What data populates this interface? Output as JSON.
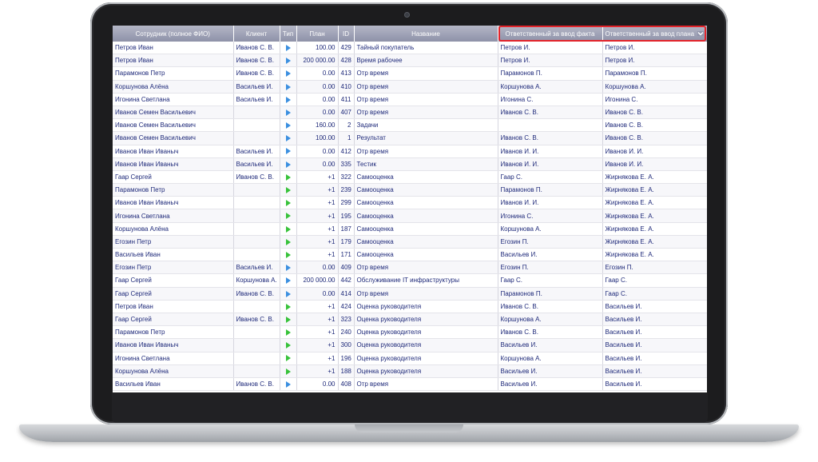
{
  "columns": {
    "employee": "Сотрудник (полное ФИО)",
    "client": "Клиент",
    "type": "Тип",
    "plan": "План",
    "id": "ID",
    "name": "Название",
    "resp_fact": "Ответственный за ввод факта",
    "resp_plan": "Ответственный за ввод плана",
    "sort_icon": "chevron-down-icon"
  },
  "rows": [
    {
      "employee": "Петров Иван",
      "client": "Иванов С. В.",
      "type": "blue",
      "plan": "100.00",
      "id": "429",
      "name": "Тайный покупатель",
      "resp_fact": "Петров И.",
      "resp_plan": "Петров И."
    },
    {
      "employee": "Петров Иван",
      "client": "Иванов С. В.",
      "type": "blue",
      "plan": "200 000.00",
      "id": "428",
      "name": "Время рабочее",
      "resp_fact": "Петров И.",
      "resp_plan": "Петров И."
    },
    {
      "employee": "Парамонов Петр",
      "client": "Иванов С. В.",
      "type": "blue",
      "plan": "0.00",
      "id": "413",
      "name": "Отр время",
      "resp_fact": "Парамонов П.",
      "resp_plan": "Парамонов П."
    },
    {
      "employee": "Коршунова Алёна",
      "client": "Васильев И.",
      "type": "blue",
      "plan": "0.00",
      "id": "410",
      "name": "Отр время",
      "resp_fact": "Коршунова А.",
      "resp_plan": "Коршунова А."
    },
    {
      "employee": "Игонина Светлана",
      "client": "Васильев И.",
      "type": "blue",
      "plan": "0.00",
      "id": "411",
      "name": "Отр время",
      "resp_fact": "Игонина С.",
      "resp_plan": "Игонина С."
    },
    {
      "employee": "Иванов Семен Васильевич",
      "client": "",
      "type": "blue",
      "plan": "0.00",
      "id": "407",
      "name": "Отр время",
      "resp_fact": "Иванов С. В.",
      "resp_plan": "Иванов С. В."
    },
    {
      "employee": "Иванов Семен Васильевич",
      "client": "",
      "type": "blue",
      "plan": "160.00",
      "id": "2",
      "name": "Задачи",
      "resp_fact": "",
      "resp_plan": "Иванов С. В."
    },
    {
      "employee": "Иванов Семен Васильевич",
      "client": "",
      "type": "blue",
      "plan": "100.00",
      "id": "1",
      "name": "Результат",
      "resp_fact": "Иванов С. В.",
      "resp_plan": "Иванов С. В."
    },
    {
      "employee": "Иванов Иван Иваныч",
      "client": "Васильев И.",
      "type": "blue",
      "plan": "0.00",
      "id": "412",
      "name": "Отр время",
      "resp_fact": "Иванов И. И.",
      "resp_plan": "Иванов И. И."
    },
    {
      "employee": "Иванов Иван Иваныч",
      "client": "Васильев И.",
      "type": "blue",
      "plan": "0.00",
      "id": "335",
      "name": "Тестик",
      "resp_fact": "Иванов И. И.",
      "resp_plan": "Иванов И. И."
    },
    {
      "employee": "Гаар Сергей",
      "client": "Иванов С. В.",
      "type": "green",
      "plan": "+1",
      "id": "322",
      "name": "Самооценка",
      "resp_fact": "Гаар С.",
      "resp_plan": "Жирнякова Е. А."
    },
    {
      "employee": "Парамонов Петр",
      "client": "",
      "type": "green",
      "plan": "+1",
      "id": "239",
      "name": "Самооценка",
      "resp_fact": "Парамонов П.",
      "resp_plan": "Жирнякова Е. А."
    },
    {
      "employee": "Иванов Иван Иваныч",
      "client": "",
      "type": "green",
      "plan": "+1",
      "id": "299",
      "name": "Самооценка",
      "resp_fact": "Иванов И. И.",
      "resp_plan": "Жирнякова Е. А."
    },
    {
      "employee": "Игонина Светлана",
      "client": "",
      "type": "green",
      "plan": "+1",
      "id": "195",
      "name": "Самооценка",
      "resp_fact": "Игонина С.",
      "resp_plan": "Жирнякова Е. А."
    },
    {
      "employee": "Коршунова Алёна",
      "client": "",
      "type": "green",
      "plan": "+1",
      "id": "187",
      "name": "Самооценка",
      "resp_fact": "Коршунова А.",
      "resp_plan": "Жирнякова Е. А."
    },
    {
      "employee": "Егозин Петр",
      "client": "",
      "type": "green",
      "plan": "+1",
      "id": "179",
      "name": "Самооценка",
      "resp_fact": "Егозин П.",
      "resp_plan": "Жирнякова Е. А."
    },
    {
      "employee": "Васильев Иван",
      "client": "",
      "type": "green",
      "plan": "+1",
      "id": "171",
      "name": "Самооценка",
      "resp_fact": "Васильев И.",
      "resp_plan": "Жирнякова Е. А."
    },
    {
      "employee": "Егозин Петр",
      "client": "Васильев И.",
      "type": "blue",
      "plan": "0.00",
      "id": "409",
      "name": "Отр время",
      "resp_fact": "Егозин П.",
      "resp_plan": "Егозин П."
    },
    {
      "employee": "Гаар Сергей",
      "client": "Коршунова А.",
      "type": "blue",
      "plan": "200 000.00",
      "id": "442",
      "name": "Обслуживание IT инфраструктуры",
      "resp_fact": "Гаар С.",
      "resp_plan": "Гаар С."
    },
    {
      "employee": "Гаар Сергей",
      "client": "Иванов С. В.",
      "type": "blue",
      "plan": "0.00",
      "id": "414",
      "name": "Отр время",
      "resp_fact": "Парамонов П.",
      "resp_plan": "Гаар С."
    },
    {
      "employee": "Петров Иван",
      "client": "",
      "type": "green",
      "plan": "+1",
      "id": "424",
      "name": "Оценка руководителя",
      "resp_fact": "Иванов С. В.",
      "resp_plan": "Васильев И."
    },
    {
      "employee": "Гаар Сергей",
      "client": "Иванов С. В.",
      "type": "green",
      "plan": "+1",
      "id": "323",
      "name": "Оценка руководителя",
      "resp_fact": "Коршунова А.",
      "resp_plan": "Васильев И."
    },
    {
      "employee": "Парамонов Петр",
      "client": "",
      "type": "green",
      "plan": "+1",
      "id": "240",
      "name": "Оценка руководителя",
      "resp_fact": "Иванов С. В.",
      "resp_plan": "Васильев И."
    },
    {
      "employee": "Иванов Иван Иваныч",
      "client": "",
      "type": "green",
      "plan": "+1",
      "id": "300",
      "name": "Оценка руководителя",
      "resp_fact": "Васильев И.",
      "resp_plan": "Васильев И."
    },
    {
      "employee": "Игонина Светлана",
      "client": "",
      "type": "green",
      "plan": "+1",
      "id": "196",
      "name": "Оценка руководителя",
      "resp_fact": "Коршунова А.",
      "resp_plan": "Васильев И."
    },
    {
      "employee": "Коршунова Алёна",
      "client": "",
      "type": "green",
      "plan": "+1",
      "id": "188",
      "name": "Оценка руководителя",
      "resp_fact": "Васильев И.",
      "resp_plan": "Васильев И."
    },
    {
      "employee": "Васильев Иван",
      "client": "Иванов С. В.",
      "type": "blue",
      "plan": "0.00",
      "id": "408",
      "name": "Отр время",
      "resp_fact": "Васильев И.",
      "resp_plan": "Васильев И."
    }
  ],
  "colors": {
    "type_blue": "#3b8fe0",
    "type_green": "#37c23a",
    "highlight": "#e3242b",
    "header_bg": "#9a9db2"
  }
}
